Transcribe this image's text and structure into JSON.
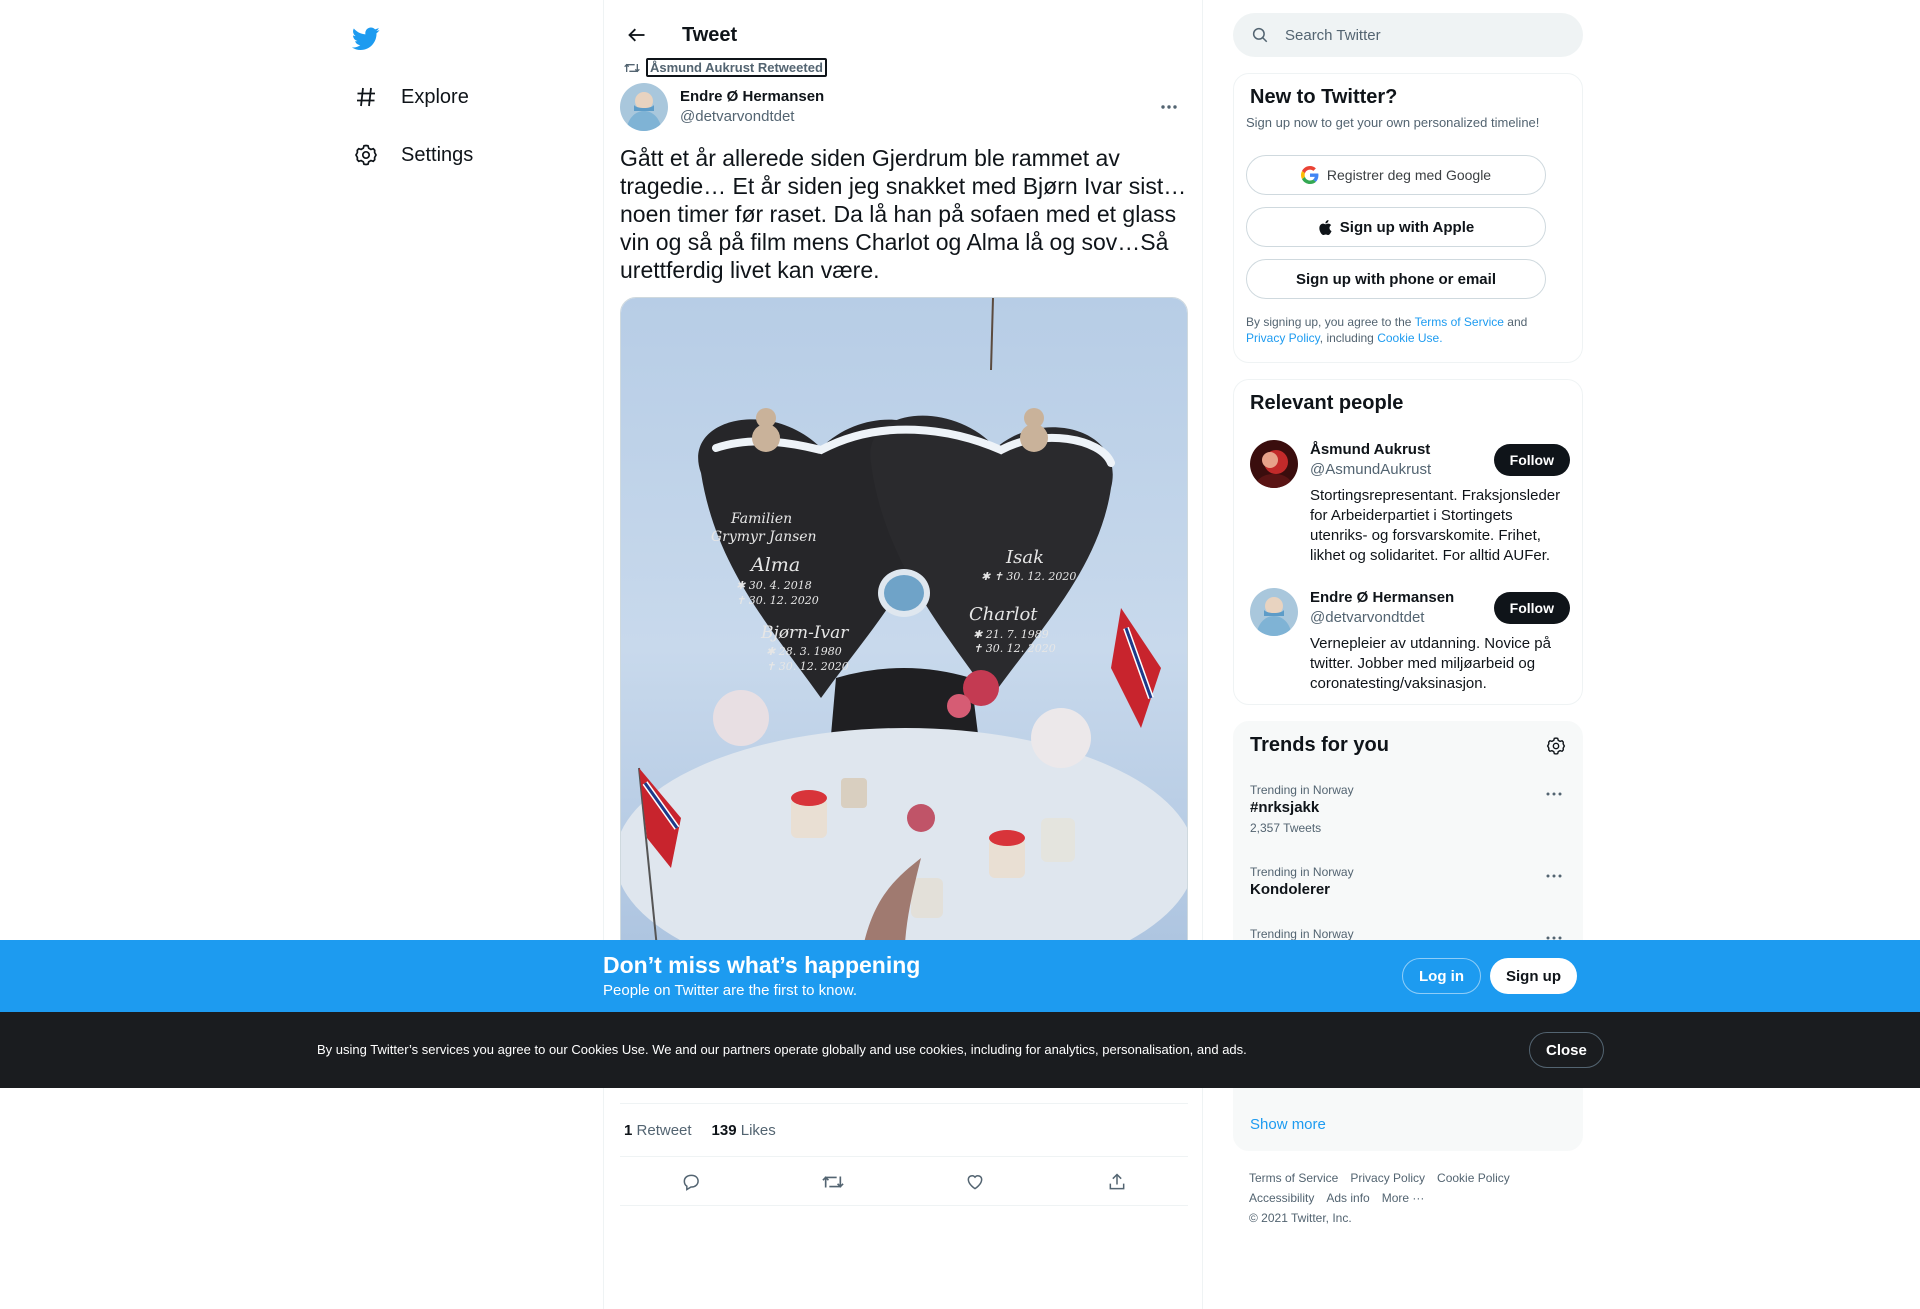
{
  "nav": {
    "items": [
      {
        "label": "Explore",
        "icon": "hashtag-icon"
      },
      {
        "label": "Settings",
        "icon": "gear-icon"
      }
    ]
  },
  "header": {
    "title": "Tweet"
  },
  "tweet": {
    "retweeted_by": "Åsmund Aukrust Retweeted",
    "author_name": "Endre Ø Hermansen",
    "author_handle": "@detvarvondtdet",
    "text": "Gått et år allerede siden Gjerdrum ble rammet av tragedie… Et år siden jeg snakket med Bjørn Ivar sist… noen timer før raset. Da lå han på sofaen med et glass vin og så på film mens Charlot og Alma lå og sov…Så urettferdig livet kan være.",
    "photo": {
      "family_label_1": "Familien",
      "family_label_2": "Grymyr Jansen",
      "name_alma": "Alma",
      "alma_birth": "✱ 30. 4. 2018",
      "alma_death": "✝ 30. 12. 2020",
      "name_bjorn": "Bjørn-Ivar",
      "bjorn_birth": "✱ 28. 3. 1980",
      "bjorn_death": "✝ 30. 12. 2020",
      "name_isak": "Isak",
      "isak_dates": "✱ ✝ 30. 12. 2020",
      "name_charlot": "Charlot",
      "charlot_birth": "✱ 21. 7. 1989",
      "charlot_death": "✝ 30. 12. 2020"
    },
    "retweets_count": "1",
    "retweets_label": "Retweet",
    "likes_count": "139",
    "likes_label": "Likes"
  },
  "search": {
    "placeholder": "Search Twitter"
  },
  "new_to_twitter": {
    "title": "New to Twitter?",
    "subtitle": "Sign up now to get your own personalized timeline!",
    "google_label": "Registrer deg med Google",
    "apple_label": "Sign up with Apple",
    "phone_label": "Sign up with phone or email",
    "terms_prefix": "By signing up, you agree to the",
    "terms_link": "Terms of Service",
    "terms_and": "and",
    "privacy_link": "Privacy Policy",
    "terms_including": ", including",
    "cookie_link": "Cookie Use."
  },
  "relevant_people": {
    "title": "Relevant people",
    "people": [
      {
        "name": "Åsmund Aukrust",
        "handle": "@AsmundAukrust",
        "bio": "Stortingsrepresentant. Fraksjonsleder for Arbeiderpartiet i Stortingets utenriks- og forsvarskomite. Frihet, likhet og solidaritet. For alltid AUFer.",
        "follow_label": "Follow"
      },
      {
        "name": "Endre Ø Hermansen",
        "handle": "@detvarvondtdet",
        "bio": "Vernepleier av utdanning. Novice på twitter. Jobber med miljøarbeid og coronatesting/vaksinasjon.",
        "follow_label": "Follow"
      }
    ]
  },
  "trends": {
    "title": "Trends for you",
    "items": [
      {
        "meta": "Trending in Norway",
        "name": "#nrksjakk",
        "count": "2,357 Tweets"
      },
      {
        "meta": "Trending in Norway",
        "name": "Kondolerer",
        "count": ""
      },
      {
        "meta": "Trending in Norway",
        "name": "",
        "count": ""
      }
    ],
    "show_more": "Show more"
  },
  "footer": {
    "links": [
      "Terms of Service",
      "Privacy Policy",
      "Cookie Policy",
      "Accessibility",
      "Ads info",
      "More ···"
    ],
    "copyright": "© 2021 Twitter, Inc."
  },
  "bottom_bar": {
    "title": "Don’t miss what’s happening",
    "subtitle": "People on Twitter are the first to know.",
    "login_label": "Log in",
    "signup_label": "Sign up"
  },
  "cookie_bar": {
    "text": "By using Twitter’s services you agree to our Cookies Use. We and our partners operate globally and use cookies, including for analytics, personalisation, and ads.",
    "close_label": "Close"
  },
  "colors": {
    "accent": "#1d9bf0",
    "text": "#0f1419",
    "muted": "#536471",
    "cookie_bg": "#1a1c1f"
  }
}
